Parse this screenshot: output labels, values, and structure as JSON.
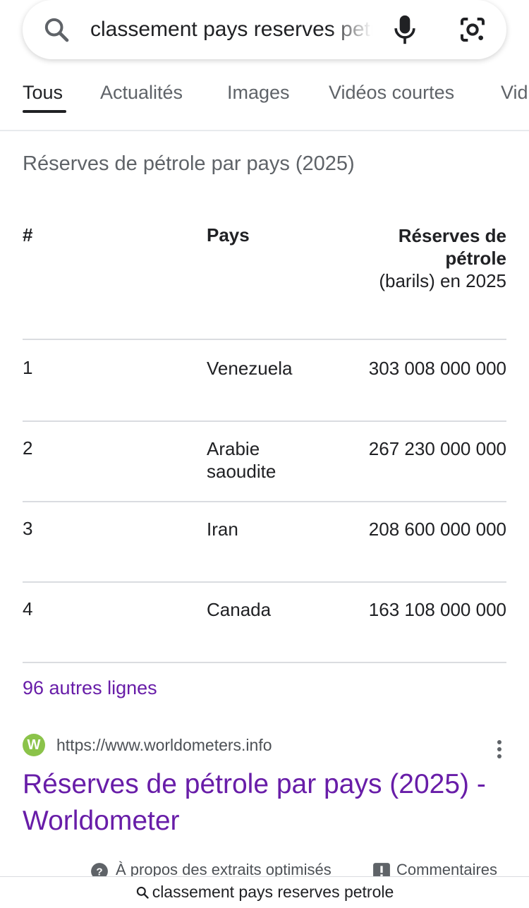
{
  "search": {
    "query": "classement pays reserves petrole"
  },
  "tabs": [
    {
      "label": "Tous",
      "active": true
    },
    {
      "label": "Actualités"
    },
    {
      "label": "Images"
    },
    {
      "label": "Vidéos courtes"
    },
    {
      "label": "Vid"
    }
  ],
  "snippet": {
    "title": "Réserves de pétrole par pays (2025)",
    "table": {
      "headers": {
        "num": "#",
        "country": "Pays",
        "reserve_bold": "Réserves de pétrole",
        "reserve_rest": "(barils) en 2025"
      },
      "rows": [
        {
          "num": "1",
          "country": "Venezuela",
          "reserve": "303 008 000 000"
        },
        {
          "num": "2",
          "country": "Arabie saoudite",
          "reserve": "267 230 000 000"
        },
        {
          "num": "3",
          "country": "Iran",
          "reserve": "208 600 000 000"
        },
        {
          "num": "4",
          "country": "Canada",
          "reserve": "163 108 000 000"
        }
      ]
    },
    "more_rows": "96 autres lignes"
  },
  "result": {
    "favicon_letter": "W",
    "url": "https://www.worldometers.info",
    "title": "Réserves de pétrole par pays (2025) - Worldometer"
  },
  "feedback": {
    "about": "À propos des extraits optimisés",
    "comments": "Commentaires"
  },
  "bottom_bar": {
    "query": "classement pays reserves petrole"
  },
  "colors": {
    "visited_link": "#681da8",
    "favicon_bg": "#8bc34a"
  }
}
